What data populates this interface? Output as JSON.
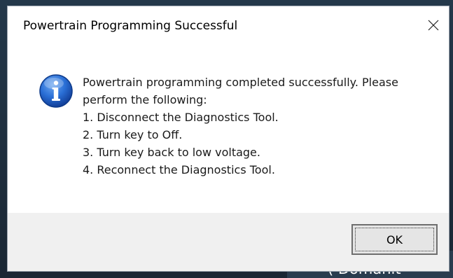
{
  "dialog": {
    "title": "Powertrain Programming Successful",
    "close_icon": "close-icon",
    "icon": "information-icon",
    "message_lines": [
      "Powertrain programming completed successfully. Please",
      "perform the following:",
      "1. Disconnect the Diagnostics Tool.",
      "2. Turn key to Off.",
      "3. Turn key back to low voltage.",
      "4. Reconnect the Diagnostics Tool."
    ],
    "ok_label": "OK"
  },
  "background": {
    "partial_text": "( Domanit"
  },
  "colors": {
    "info_icon_blue": "#2a6fd6",
    "dialog_bg": "#f0f0f0",
    "content_bg": "#ffffff"
  }
}
